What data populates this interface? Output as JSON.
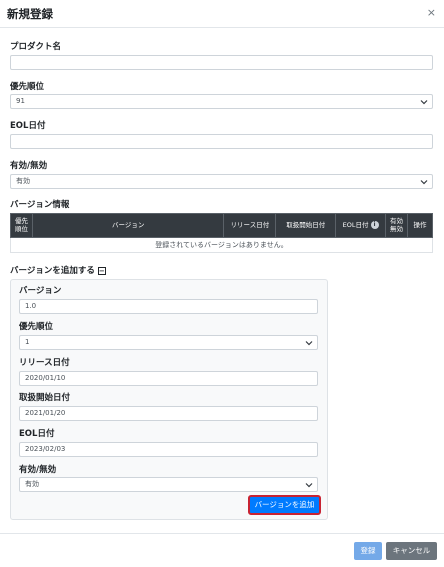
{
  "dialog": {
    "title": "新規登録",
    "close_symbol": "×"
  },
  "form": {
    "product_name": {
      "label": "プロダクト名",
      "value": ""
    },
    "priority": {
      "label": "優先順位",
      "value": "91"
    },
    "eol_date": {
      "label": "EOL日付",
      "value": ""
    },
    "enabled": {
      "label": "有効/無効",
      "value": "有効"
    }
  },
  "version_info": {
    "title": "バージョン情報",
    "columns": [
      "優先\n順位",
      "バージョン",
      "リリース日付",
      "取扱開始日付",
      "EOL日付",
      "有効\n無効",
      "操作"
    ],
    "empty_message": "登録されているバージョンはありません。"
  },
  "add_version": {
    "toggle_label": "バージョンを追加する",
    "toggle_symbol": "−",
    "version": {
      "label": "バージョン",
      "value": "1.0"
    },
    "priority": {
      "label": "優先順位",
      "value": "1"
    },
    "release_date": {
      "label": "リリース日付",
      "value": "2020/01/10"
    },
    "handling_start_date": {
      "label": "取扱開始日付",
      "value": "2021/01/20"
    },
    "eol_date": {
      "label": "EOL日付",
      "value": "2023/02/03"
    },
    "enabled": {
      "label": "有効/無効",
      "value": "有効"
    },
    "add_button_label": "バージョンを追加"
  },
  "footer": {
    "register_label": "登録",
    "cancel_label": "キャンセル"
  },
  "colors": {
    "primary": "#007bff",
    "primary_disabled": "#74a9e8",
    "secondary": "#6c757d",
    "table_header": "#343a40",
    "highlight_border": "#c82333"
  },
  "icons": {
    "close": "close-icon",
    "chevron": "chevron-down-icon",
    "info": "info-icon",
    "collapse": "minus-square-icon"
  }
}
